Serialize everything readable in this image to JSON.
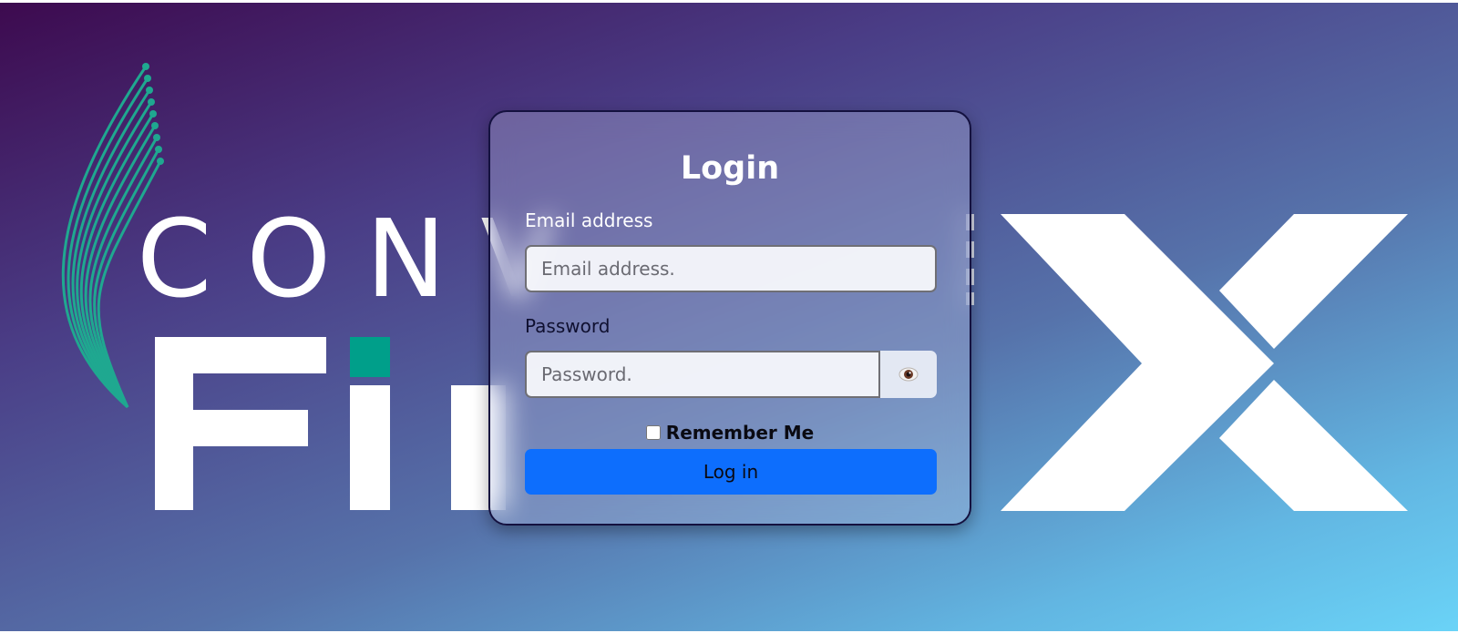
{
  "colors": {
    "gradient_start": "#3d0a4f",
    "gradient_end": "#6ad3f7",
    "logo_accent": "#009f8a",
    "login_button": "#0d6efd"
  },
  "logo": {
    "icon": "fiber-strands-logo",
    "visible_text_line1": "CONV",
    "visible_text_line2": "FIB"
  },
  "login": {
    "title": "Login",
    "email_label": "Email address",
    "email_placeholder": "Email address.",
    "password_label": "Password",
    "password_placeholder": "Password.",
    "show_password_icon": "eye-icon",
    "remember_label": "Remember Me",
    "remember_checked": false,
    "submit_label": "Log in"
  }
}
